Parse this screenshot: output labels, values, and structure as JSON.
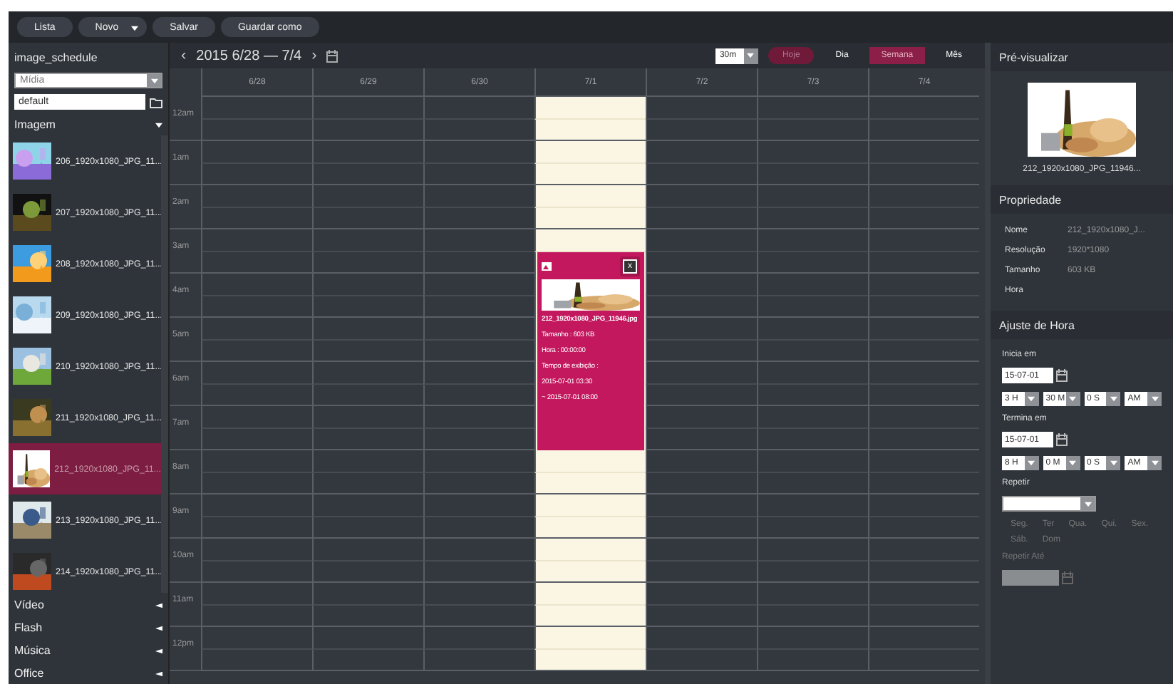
{
  "toolbar": [
    {
      "label": "Lista",
      "kind": "button"
    },
    {
      "label": "Novo",
      "kind": "dropdown"
    },
    {
      "label": "Salvar",
      "kind": "button"
    },
    {
      "label": "Guardar como",
      "kind": "button"
    }
  ],
  "sidebar": {
    "title": "image_schedule",
    "media_select": "Mídia",
    "folder_input": "default",
    "sections": [
      {
        "label": "Imagem",
        "expanded": true,
        "items": [
          {
            "label": "206_1920x1080_JPG_11...",
            "selected": false
          },
          {
            "label": "207_1920x1080_JPG_11...",
            "selected": false
          },
          {
            "label": "208_1920x1080_JPG_11...",
            "selected": false
          },
          {
            "label": "209_1920x1080_JPG_11...",
            "selected": false
          },
          {
            "label": "210_1920x1080_JPG_11...",
            "selected": false
          },
          {
            "label": "211_1920x1080_JPG_11...",
            "selected": false
          },
          {
            "label": "212_1920x1080_JPG_11...",
            "selected": true
          },
          {
            "label": "213_1920x1080_JPG_11...",
            "selected": false
          },
          {
            "label": "214_1920x1080_JPG_11...",
            "selected": false
          }
        ]
      },
      {
        "label": "Vídeo",
        "expanded": false
      },
      {
        "label": "Flash",
        "expanded": false
      },
      {
        "label": "Música",
        "expanded": false
      },
      {
        "label": "Office",
        "expanded": false
      }
    ]
  },
  "calendar": {
    "range": "2015 6/28 — 7/4",
    "prev": "‹",
    "next": "›",
    "interval": "30m",
    "today": "Hoje",
    "views": [
      {
        "label": "Dia",
        "selected": false
      },
      {
        "label": "Semana",
        "selected": true
      },
      {
        "label": "Mês",
        "selected": false
      }
    ],
    "days": [
      {
        "label": "6/28",
        "selected": false
      },
      {
        "label": "6/29",
        "selected": false
      },
      {
        "label": "6/30",
        "selected": false
      },
      {
        "label": "7/1",
        "selected": true,
        "event": {
          "close": "x",
          "lines": [
            "212_1920x1080_JPG_11946.jpg",
            "Tamanho : 603 KB",
            "Hora : 00:00:00",
            "Tempo de exibição :",
            "2015-07-01 03:30",
            "~ 2015-07-01 08:00"
          ]
        }
      },
      {
        "label": "7/2",
        "selected": false
      },
      {
        "label": "7/3",
        "selected": false
      },
      {
        "label": "7/4",
        "selected": false
      }
    ],
    "hours": [
      "12am",
      "1am",
      "2am",
      "3am",
      "4am",
      "5am",
      "6am",
      "7am",
      "8am",
      "9am",
      "10am",
      "11am",
      "12pm"
    ]
  },
  "preview": {
    "title": "Pré-visualizar",
    "caption": "212_1920x1080_JPG_11946..."
  },
  "properties": {
    "title": "Propriedade",
    "rows": [
      {
        "key": "Nome",
        "value": "212_1920x1080_J..."
      },
      {
        "key": "Resolução",
        "value": "1920*1080"
      },
      {
        "key": "Tamanho",
        "value": "603 KB"
      },
      {
        "key": "Hora"
      }
    ]
  },
  "time": {
    "title": "Ajuste de Hora",
    "start": {
      "label": "Inicia em",
      "date": "15-07-01",
      "parts": [
        "3 H",
        "30 M",
        "0 S",
        "AM"
      ]
    },
    "end": {
      "label": "Termina em",
      "date": "15-07-01",
      "parts": [
        "8 H",
        "0 M",
        "0 S",
        "AM"
      ]
    },
    "repeat_label": "Repetir",
    "weekdays": [
      "Seg.",
      "Ter",
      "Qua.",
      "Qui.",
      "Sex.",
      "Sáb.",
      "Dom"
    ],
    "repeat_until": {
      "label": "Repetir Até",
      "disabled": true
    }
  }
}
